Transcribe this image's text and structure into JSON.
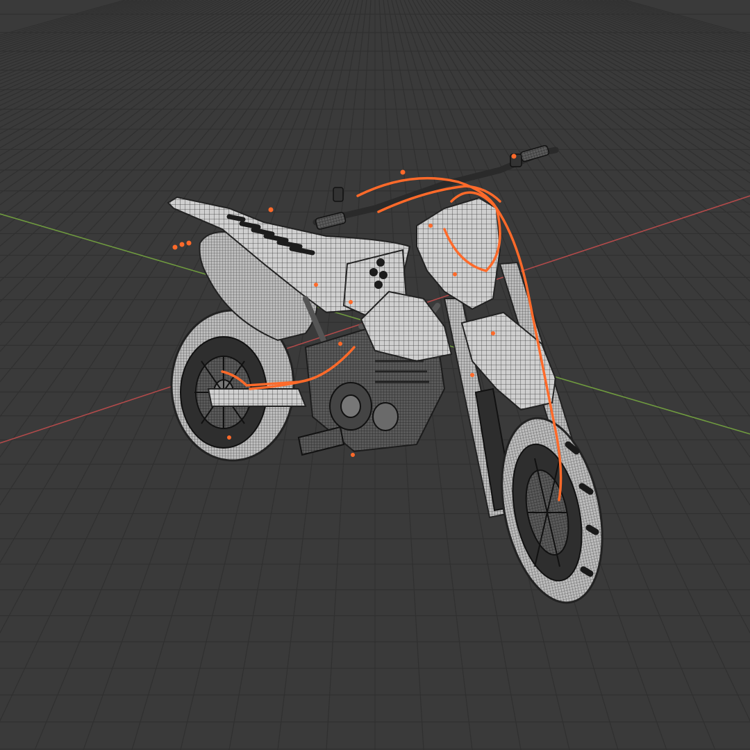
{
  "viewport": {
    "background_color": "#3a3a3a",
    "grid_color": "#303030",
    "x_axis_color": "#b14a4a",
    "y_axis_color": "#6f9a3f",
    "selection_color": "#ff6a2a",
    "mesh_color": "#cfcfcf",
    "mesh_dark_color": "#2a2a2a",
    "object_icon": "motorcycle-wireframe"
  }
}
